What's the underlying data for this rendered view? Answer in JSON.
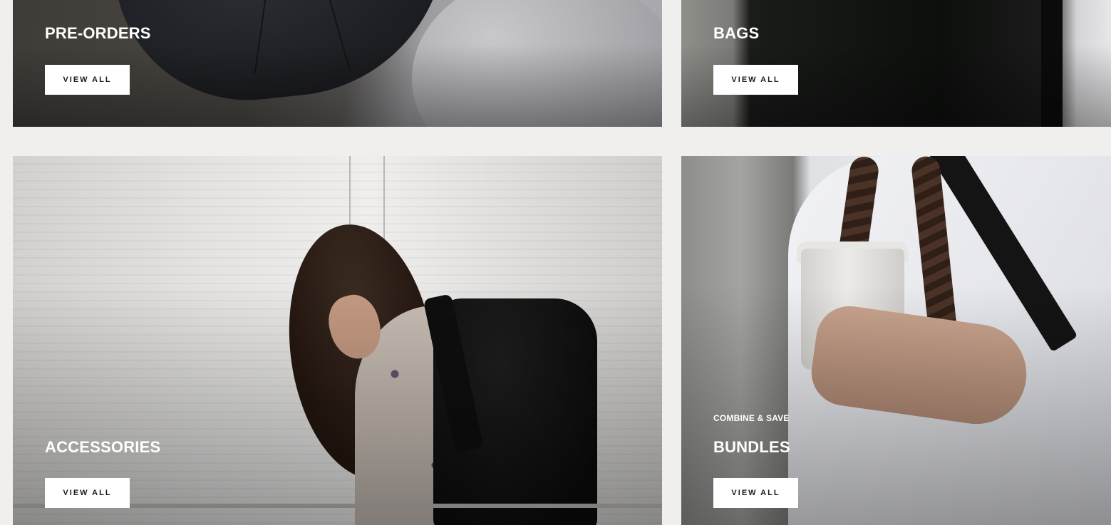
{
  "collections": [
    {
      "title": "PRE-ORDERS",
      "eyebrow": "",
      "cta": "VIEW ALL"
    },
    {
      "title": "BAGS",
      "eyebrow": "",
      "cta": "VIEW ALL"
    },
    {
      "title": "ACCESSORIES",
      "eyebrow": "",
      "cta": "VIEW ALL"
    },
    {
      "title": "BUNDLES",
      "eyebrow": "COMBINE & SAVE",
      "cta": "VIEW ALL"
    }
  ],
  "colors": {
    "page_background": "#f0efed",
    "button_background": "#ffffff",
    "button_text": "#1b1b1b",
    "overlay_text": "#ffffff"
  }
}
